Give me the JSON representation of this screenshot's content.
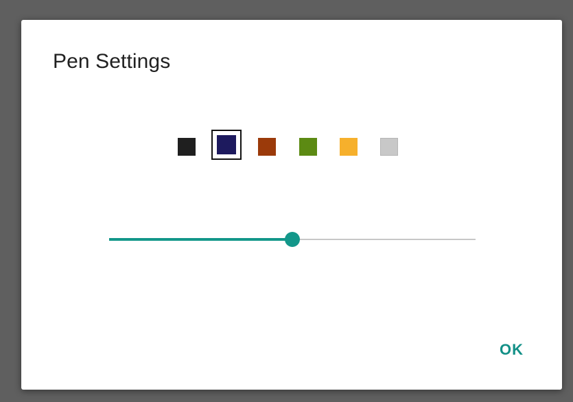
{
  "dialog": {
    "title": "Pen Settings",
    "ok_label": "OK",
    "colors": [
      {
        "name": "black",
        "hex": "#1f1f1f",
        "selected": false
      },
      {
        "name": "navy",
        "hex": "#1d1a5e",
        "selected": true
      },
      {
        "name": "rust",
        "hex": "#9b3a0a",
        "selected": false
      },
      {
        "name": "olive-green",
        "hex": "#5c8a13",
        "selected": false
      },
      {
        "name": "amber",
        "hex": "#f6b02c",
        "selected": false
      },
      {
        "name": "light-gray",
        "hex": "#c8c8c8",
        "selected": false
      }
    ],
    "pen_size": {
      "value_fraction": 0.5
    },
    "accent_color": "#13978a"
  }
}
